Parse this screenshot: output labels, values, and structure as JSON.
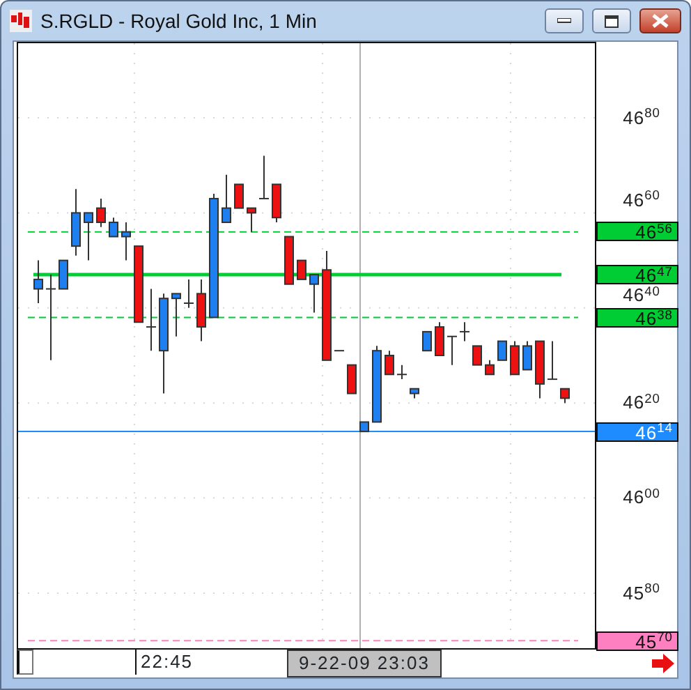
{
  "window": {
    "title": "S.RGLD - Royal Gold Inc, 1 Min"
  },
  "chart": {
    "y_ticks": [
      {
        "label": "46$^{80}$"
      },
      {
        "label": "46$^{60}$"
      },
      {
        "label": "46$^{40}$"
      },
      {
        "label": "46$^{20}$"
      },
      {
        "label": "46$^{00}$"
      },
      {
        "label": "45$^{80}$"
      }
    ],
    "levels": [
      {
        "kind": "dashed",
        "label": "46$^{56}$",
        "color": "#00cc33"
      },
      {
        "kind": "solid",
        "label": "46$^{47}$",
        "color": "#00cc33"
      },
      {
        "kind": "dashed",
        "label": "46$^{38}$",
        "color": "#00cc33"
      },
      {
        "kind": "crosshair",
        "label": "46$^{14}$",
        "color": "#1e8cff"
      },
      {
        "kind": "dashed",
        "label": "45$^{70}$",
        "color": "#ff80c0"
      }
    ]
  },
  "time_axis": {
    "labels": [
      {
        "label": "22:45"
      }
    ],
    "crosshair": {
      "label": "9-22-09 23:03"
    }
  }
}
